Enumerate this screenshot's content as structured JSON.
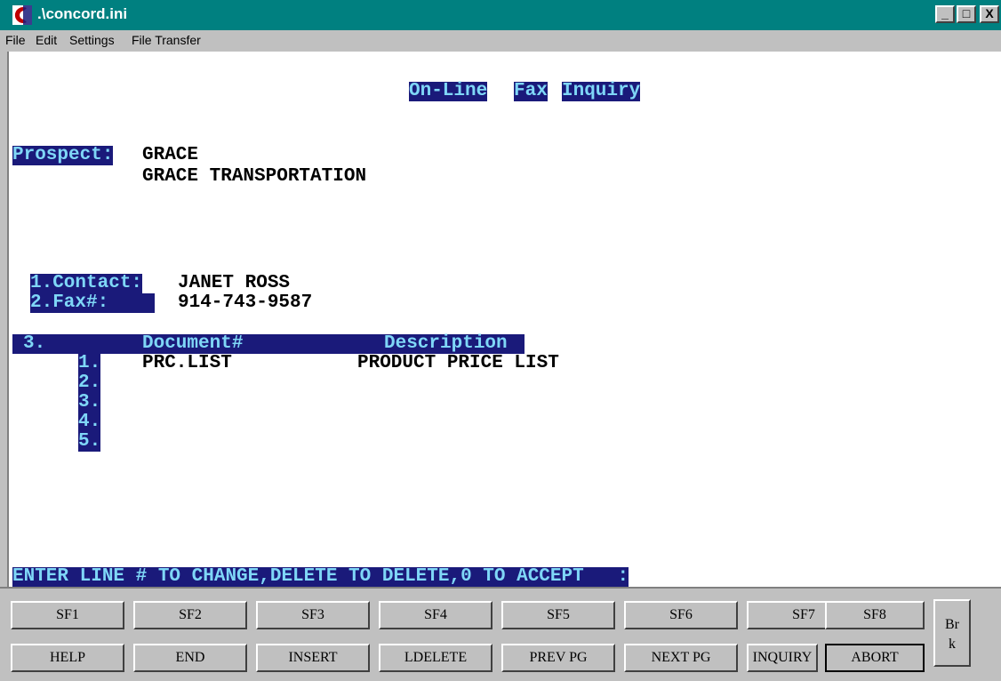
{
  "window": {
    "title": ".\\concord.ini",
    "min_label": "_",
    "max_label": "□",
    "close_label": "X"
  },
  "menu": {
    "file": "File",
    "edit": "Edit",
    "settings": "Settings",
    "file_transfer": "File Transfer"
  },
  "screen": {
    "heading_words": [
      "On-Line",
      "Fax",
      "Inquiry"
    ],
    "prospect_label": "Prospect:",
    "prospect_code": "GRACE",
    "prospect_name": "GRACE TRANSPORTATION",
    "contact_label": "1.Contact:",
    "contact_value": "JANET ROSS",
    "fax_label": "2.Fax#:",
    "fax_value": "914-743-9587",
    "docs_header": {
      "num": "3.",
      "document": "Document#",
      "description": "Description"
    },
    "documents": [
      {
        "num": "1.",
        "document": "PRC.LIST",
        "description": "PRODUCT PRICE LIST"
      },
      {
        "num": "2.",
        "document": "",
        "description": ""
      },
      {
        "num": "3.",
        "document": "",
        "description": ""
      },
      {
        "num": "4.",
        "document": "",
        "description": ""
      },
      {
        "num": "5.",
        "document": "",
        "description": ""
      }
    ],
    "prompt": "ENTER LINE # TO CHANGE,DELETE TO DELETE,0 TO ACCEPT   :"
  },
  "function_keys": {
    "top": [
      "SF1",
      "SF2",
      "SF3",
      "SF4",
      "SF5",
      "SF6",
      "SF7",
      "SF8"
    ],
    "bottom": [
      "HELP",
      "END",
      "INSERT",
      "LDELETE",
      "PREV PG",
      "NEXT PG",
      "INQUIRY",
      "ABORT"
    ],
    "brk_line1": "Br",
    "brk_line2": "k"
  },
  "colors": {
    "titlebar": "#008080",
    "highlight_bg": "#1a1a7a",
    "highlight_fg": "#7fd7f7",
    "terminal_bg": "#ffffff"
  }
}
